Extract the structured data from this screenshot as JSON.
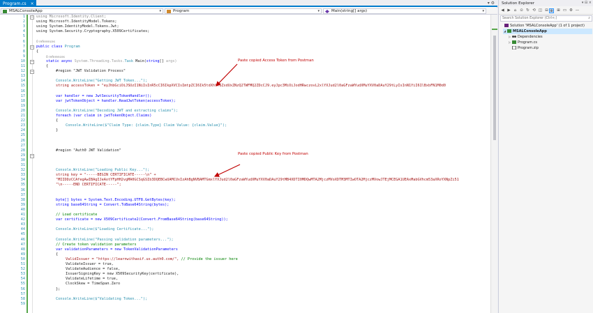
{
  "editor": {
    "tab": {
      "title": "Program.cs",
      "close": "×"
    },
    "tab_icons": "▾ ⚙",
    "nav": {
      "project": "MSALConsoleApp",
      "class": "Program",
      "member": "Main(string[] args)"
    }
  },
  "line_numbers": [
    "1",
    "2",
    "3",
    "4",
    "5",
    "6",
    "7",
    "8",
    "9",
    "10",
    "11",
    "12",
    "13",
    "14",
    "15",
    "16",
    "17",
    "18",
    "19",
    "20",
    "21",
    "22",
    "23",
    "24",
    "25",
    "26",
    "27",
    "28",
    "29",
    "30",
    "31",
    "32",
    "33",
    "34",
    "35",
    "36",
    "37",
    "38",
    "39",
    "40",
    "41",
    "42",
    "43",
    "44",
    "45",
    "46",
    "47",
    "48",
    "49",
    "50",
    "51",
    "52",
    "53",
    "54",
    "55",
    "56",
    "57",
    "58",
    "59"
  ],
  "code": {
    "l1": "using Microsoft.Identity.Client;",
    "l2": "using Microsoft.IdentityModel.Tokens;",
    "l3": "using System.IdentityModel.Tokens.Jwt;",
    "l4": "using System.Security.Cryptography.X509Certificates;",
    "refs0": "0 references",
    "l6": "public class Program",
    "l7": "{",
    "refs1": "0 references",
    "l8": "static async System.Threading.Tasks.Task Main(string[] args)",
    "l9": "{",
    "l10": "#region \"JWT Validation Process\"",
    "l12": "Console.WriteLine(\"Getting JWT Token...\");",
    "l13": "string accessToken = \"eyJhbGciOiJSUzI1NiIsInR5cCI6IkpXVCIsImtpZCI6Ik5tdXhYTGZxdUxZNzQ2TWFMQ2ZDcCJ9.eyJpc3MiOiJodHRwczovL2xlYXJud2l0aGFzaWYudXMuYXV0aDAuY29tLyIsInN1YiI6IlBxbFN1M0d0",
    "l15": "var handler = new JwtSecurityTokenHandler();",
    "l16": "var jwtTokenObject = handler.ReadJwtToken(accessToken);",
    "l18": "Console.WriteLine(\"Decoding JWT and extracting claims\");",
    "l19": "foreach (var claim in jwtTokenObject.Claims)",
    "l20": "{",
    "l21": "Console.WriteLine($\"Claim Type: {claim.Type} Claim Value: {claim.Value}\");",
    "l22": "}",
    "l25": "#region \"Auth0 JWT Validation\"",
    "l28": "Console.WriteLine(\"Loading Public Key...\");",
    "l29": "string key = \"-----BEGIN CERTIFICATE-----\\n\" +",
    "l30": "\"MIIDDzCCAfegAwIBAgIJeAotYFpHH2vgMA0GCSqGSIb3DQEBCwUAMCUxIzAhBgNVBAMTGmxlYXJud2l0aGFzaWYudXMuYXV0aDAuY29tMB4XDTI0MDQwMTA2MjczMVoXDTM3MTIwOTA2MjczMVowJTEjMCEGA1UEAxMabGVhcm53aXRoYXNpZi51",
    "l31": "\"\\n-----END CERTIFICATE-----\";",
    "l34": "byte[] bytes = System.Text.Encoding.UTF8.GetBytes(key);",
    "l35": "string base64String = Convert.ToBase64String(bytes);",
    "l37": "// Load certificate",
    "l38": "var certificate = new X509Certificate2(Convert.FromBase64String(base64String));",
    "l40": "Console.WriteLine($\"Loading Certificate...\");",
    "l42": "Console.WriteLine(\"Passing validation parameters...\");",
    "l43": "// Create token validation parameters",
    "l44": "var validationParameters = new TokenValidationParameters",
    "l45": "{",
    "l46a": "ValidIssuer = \"https://learnwithasif.us.auth0.com/\",",
    "l46b": " // Provide the issuer here",
    "l47": "ValidateIssuer = true,",
    "l48": "ValidateAudience = false,",
    "l49": "IssuerSigningKey = new X509SecurityKey(certificate),",
    "l50": "ValidateLifetime = true,",
    "l51": "ClockSkew = TimeSpan.Zero",
    "l52": "};",
    "l54": "Console.WriteLine($\"Validating Token...\");"
  },
  "annotations": {
    "access_token": "Paste copied Access Token from Postman",
    "public_key": "Paste copied Public Key from Postman"
  },
  "solution_explorer": {
    "title": "Solution Explorer",
    "title_icons": "▾ ⊟ ×",
    "search_placeholder": "Search Solution Explorer (Ctrl+;)",
    "search_icon": "⌕",
    "toolbar_icons": [
      "◀",
      "▶",
      "⌂",
      "⊙",
      "↻",
      "⟲",
      "◫",
      "⊟",
      "⊕",
      "⊞",
      "▭",
      "⚙",
      "—"
    ],
    "tree": [
      {
        "label": "Solution 'MSALConsoleApp' (1 of 1 project)",
        "expander": "",
        "icon": "solution-icon"
      },
      {
        "label": "MSALConsoleApp",
        "expander": "◢",
        "icon": "csharp-project-icon"
      },
      {
        "label": "Dependencies",
        "expander": "▷",
        "icon": "dependencies-icon"
      },
      {
        "label": "Program.cs",
        "expander": "▷",
        "icon": "csharp-file-icon"
      },
      {
        "label": "Program.zip",
        "expander": "",
        "icon": "zip-file-icon"
      }
    ]
  },
  "colors": {
    "accent": "#007acc",
    "keyword": "#0000ff",
    "type": "#2b91af",
    "string": "#a31515",
    "comment": "#008000",
    "annotation": "#c00000",
    "change_bar": "#57a64a",
    "selection": "#cce8ff"
  }
}
